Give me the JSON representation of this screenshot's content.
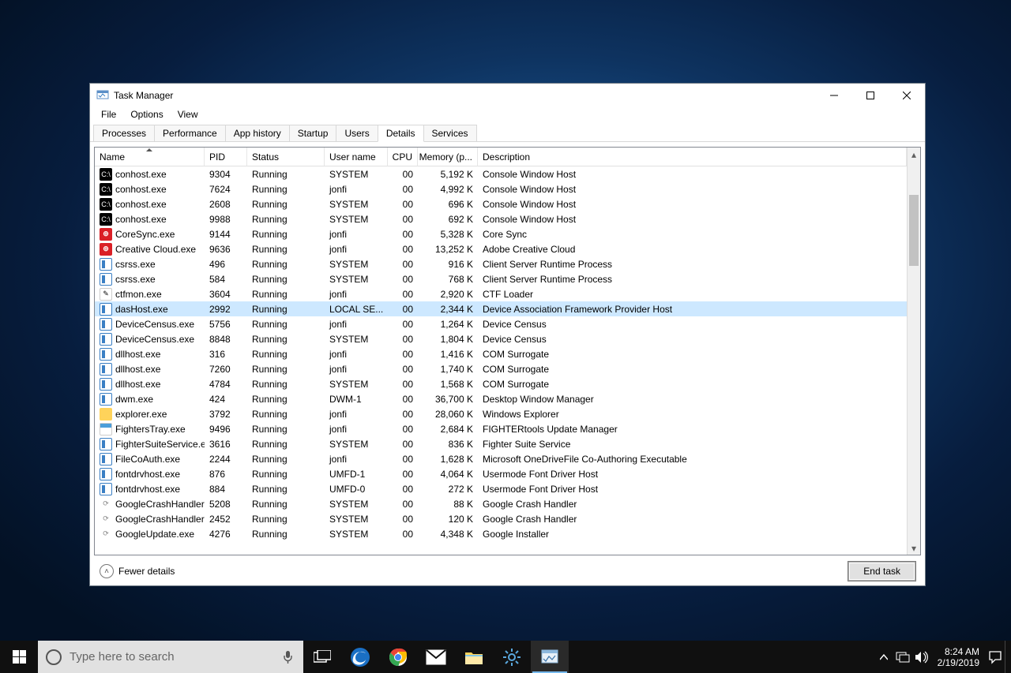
{
  "window": {
    "title": "Task Manager",
    "menus": [
      "File",
      "Options",
      "View"
    ],
    "tabs": [
      "Processes",
      "Performance",
      "App history",
      "Startup",
      "Users",
      "Details",
      "Services"
    ],
    "active_tab_index": 5,
    "columns": [
      "Name",
      "PID",
      "Status",
      "User name",
      "CPU",
      "Memory (p...",
      "Description"
    ],
    "sort_column_index": 0,
    "fewer_label": "Fewer details",
    "end_task_label": "End task"
  },
  "rows": [
    {
      "icon": "console",
      "name": "conhost.exe",
      "pid": "9304",
      "status": "Running",
      "user": "SYSTEM",
      "cpu": "00",
      "mem": "5,192 K",
      "desc": "Console Window Host"
    },
    {
      "icon": "console",
      "name": "conhost.exe",
      "pid": "7624",
      "status": "Running",
      "user": "jonfi",
      "cpu": "00",
      "mem": "4,992 K",
      "desc": "Console Window Host"
    },
    {
      "icon": "console",
      "name": "conhost.exe",
      "pid": "2608",
      "status": "Running",
      "user": "SYSTEM",
      "cpu": "00",
      "mem": "696 K",
      "desc": "Console Window Host"
    },
    {
      "icon": "console",
      "name": "conhost.exe",
      "pid": "9988",
      "status": "Running",
      "user": "SYSTEM",
      "cpu": "00",
      "mem": "692 K",
      "desc": "Console Window Host"
    },
    {
      "icon": "cc",
      "name": "CoreSync.exe",
      "pid": "9144",
      "status": "Running",
      "user": "jonfi",
      "cpu": "00",
      "mem": "5,328 K",
      "desc": "Core Sync"
    },
    {
      "icon": "cc",
      "name": "Creative Cloud.exe",
      "pid": "9636",
      "status": "Running",
      "user": "jonfi",
      "cpu": "00",
      "mem": "13,252 K",
      "desc": "Adobe Creative Cloud"
    },
    {
      "icon": "sys",
      "name": "csrss.exe",
      "pid": "496",
      "status": "Running",
      "user": "SYSTEM",
      "cpu": "00",
      "mem": "916 K",
      "desc": "Client Server Runtime Process"
    },
    {
      "icon": "sys",
      "name": "csrss.exe",
      "pid": "584",
      "status": "Running",
      "user": "SYSTEM",
      "cpu": "00",
      "mem": "768 K",
      "desc": "Client Server Runtime Process"
    },
    {
      "icon": "pen",
      "name": "ctfmon.exe",
      "pid": "3604",
      "status": "Running",
      "user": "jonfi",
      "cpu": "00",
      "mem": "2,920 K",
      "desc": "CTF Loader"
    },
    {
      "icon": "sys",
      "name": "dasHost.exe",
      "pid": "2992",
      "status": "Running",
      "user": "LOCAL SE...",
      "cpu": "00",
      "mem": "2,344 K",
      "desc": "Device Association Framework Provider Host",
      "selected": true
    },
    {
      "icon": "sys",
      "name": "DeviceCensus.exe",
      "pid": "5756",
      "status": "Running",
      "user": "jonfi",
      "cpu": "00",
      "mem": "1,264 K",
      "desc": "Device Census"
    },
    {
      "icon": "sys",
      "name": "DeviceCensus.exe",
      "pid": "8848",
      "status": "Running",
      "user": "SYSTEM",
      "cpu": "00",
      "mem": "1,804 K",
      "desc": "Device Census"
    },
    {
      "icon": "sys",
      "name": "dllhost.exe",
      "pid": "316",
      "status": "Running",
      "user": "jonfi",
      "cpu": "00",
      "mem": "1,416 K",
      "desc": "COM Surrogate"
    },
    {
      "icon": "sys",
      "name": "dllhost.exe",
      "pid": "7260",
      "status": "Running",
      "user": "jonfi",
      "cpu": "00",
      "mem": "1,740 K",
      "desc": "COM Surrogate"
    },
    {
      "icon": "sys",
      "name": "dllhost.exe",
      "pid": "4784",
      "status": "Running",
      "user": "SYSTEM",
      "cpu": "00",
      "mem": "1,568 K",
      "desc": "COM Surrogate"
    },
    {
      "icon": "sys",
      "name": "dwm.exe",
      "pid": "424",
      "status": "Running",
      "user": "DWM-1",
      "cpu": "00",
      "mem": "36,700 K",
      "desc": "Desktop Window Manager"
    },
    {
      "icon": "folder",
      "name": "explorer.exe",
      "pid": "3792",
      "status": "Running",
      "user": "jonfi",
      "cpu": "00",
      "mem": "28,060 K",
      "desc": "Windows Explorer"
    },
    {
      "icon": "app",
      "name": "FightersTray.exe",
      "pid": "9496",
      "status": "Running",
      "user": "jonfi",
      "cpu": "00",
      "mem": "2,684 K",
      "desc": "FIGHTERtools Update Manager"
    },
    {
      "icon": "sys",
      "name": "FighterSuiteService.e...",
      "pid": "3616",
      "status": "Running",
      "user": "SYSTEM",
      "cpu": "00",
      "mem": "836 K",
      "desc": "Fighter Suite Service"
    },
    {
      "icon": "sys",
      "name": "FileCoAuth.exe",
      "pid": "2244",
      "status": "Running",
      "user": "jonfi",
      "cpu": "00",
      "mem": "1,628 K",
      "desc": "Microsoft OneDriveFile Co-Authoring Executable"
    },
    {
      "icon": "sys",
      "name": "fontdrvhost.exe",
      "pid": "876",
      "status": "Running",
      "user": "UMFD-1",
      "cpu": "00",
      "mem": "4,064 K",
      "desc": "Usermode Font Driver Host"
    },
    {
      "icon": "sys",
      "name": "fontdrvhost.exe",
      "pid": "884",
      "status": "Running",
      "user": "UMFD-0",
      "cpu": "00",
      "mem": "272 K",
      "desc": "Usermode Font Driver Host"
    },
    {
      "icon": "g",
      "name": "GoogleCrashHandler...",
      "pid": "5208",
      "status": "Running",
      "user": "SYSTEM",
      "cpu": "00",
      "mem": "88 K",
      "desc": "Google Crash Handler"
    },
    {
      "icon": "g",
      "name": "GoogleCrashHandler...",
      "pid": "2452",
      "status": "Running",
      "user": "SYSTEM",
      "cpu": "00",
      "mem": "120 K",
      "desc": "Google Crash Handler"
    },
    {
      "icon": "g",
      "name": "GoogleUpdate.exe",
      "pid": "4276",
      "status": "Running",
      "user": "SYSTEM",
      "cpu": "00",
      "mem": "4,348 K",
      "desc": "Google Installer"
    }
  ],
  "taskbar": {
    "search_placeholder": "Type here to search",
    "clock_time": "8:24 AM",
    "clock_date": "2/19/2019"
  }
}
